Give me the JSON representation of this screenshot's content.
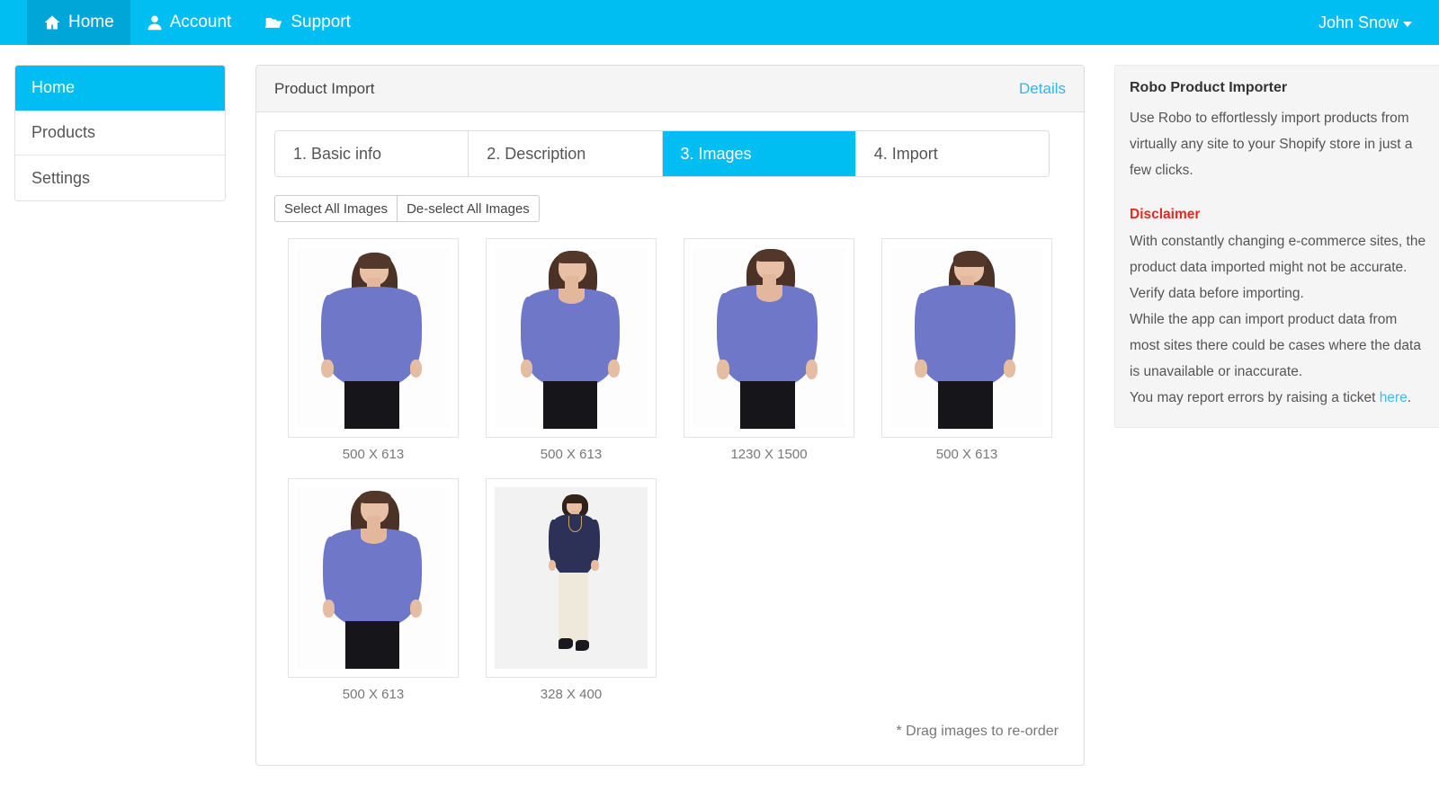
{
  "navbar": {
    "items": [
      {
        "label": "Home",
        "icon": "home-icon",
        "active": true
      },
      {
        "label": "Account",
        "icon": "user-icon",
        "active": false
      },
      {
        "label": "Support",
        "icon": "folder-icon",
        "active": false
      }
    ],
    "user": "John Snow"
  },
  "sidebar": {
    "items": [
      {
        "label": "Home",
        "active": true
      },
      {
        "label": "Products",
        "active": false
      },
      {
        "label": "Settings",
        "active": false
      }
    ]
  },
  "panel": {
    "title": "Product Import",
    "details_link": "Details",
    "tabs": [
      {
        "label": "1. Basic info",
        "active": false
      },
      {
        "label": "2. Description",
        "active": false
      },
      {
        "label": "3. Images",
        "active": true
      },
      {
        "label": "4. Import",
        "active": false
      }
    ],
    "buttons": {
      "select_all": "Select All Images",
      "deselect_all": "De-select All Images"
    },
    "images": [
      {
        "dimensions": "500 X 613",
        "view": "back",
        "garment": "periwinkle-tunic",
        "pants": "black"
      },
      {
        "dimensions": "500 X 613",
        "view": "front",
        "garment": "periwinkle-tunic",
        "pants": "black"
      },
      {
        "dimensions": "1230 X 1500",
        "view": "front",
        "garment": "periwinkle-tunic",
        "pants": "black"
      },
      {
        "dimensions": "500 X 613",
        "view": "back",
        "garment": "periwinkle-tunic",
        "pants": "black"
      },
      {
        "dimensions": "500 X 613",
        "view": "front",
        "garment": "periwinkle-tunic",
        "pants": "black"
      },
      {
        "dimensions": "328 X 400",
        "view": "full-body",
        "garment": "navy-tunic",
        "pants": "cream"
      }
    ],
    "drag_note": "* Drag images to re-order"
  },
  "rightbar": {
    "title": "Robo Product Importer",
    "intro": "Use Robo to effortlessly import products from virtually any site to your Shopify store in just a few clicks.",
    "disclaimer_title": "Disclaimer",
    "disclaimer_line1": "With constantly changing e-commerce sites, the product data imported might not be accurate. Verify data before importing.",
    "disclaimer_line2": "While the app can import product data from most sites there could be cases where the data is unavailable or inaccurate.",
    "disclaimer_line3_pre": "You may report errors by raising a ticket ",
    "disclaimer_link": "here",
    "disclaimer_line3_post": "."
  },
  "colors": {
    "accent": "#00bdf2",
    "accent_dark": "#00a6d8",
    "link": "#2bb8ef",
    "danger": "#e02b20",
    "panel_head": "#f5f5f5"
  }
}
